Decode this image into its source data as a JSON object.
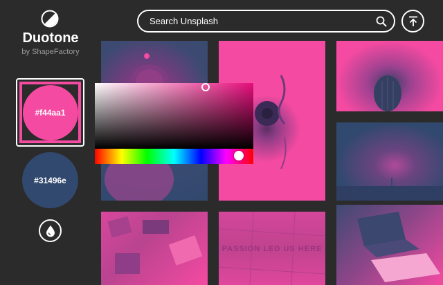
{
  "app": {
    "title": "Duotone",
    "subtitle": "by ShapeFactory",
    "logo_icon": "half-circle-icon"
  },
  "colors": {
    "primary": "#f44aa1",
    "secondary": "#31496e",
    "background": "#2b2b2b"
  },
  "swatches": {
    "primary_label": "#f44aa1",
    "secondary_label": "#31496e"
  },
  "search": {
    "placeholder": "Search Unsplash",
    "icon": "search-icon"
  },
  "actions": {
    "upload_icon": "upload-icon",
    "drop_icon": "droplet-icon"
  },
  "gallery": {
    "tile6_text": "PASSION LED US HERE"
  }
}
